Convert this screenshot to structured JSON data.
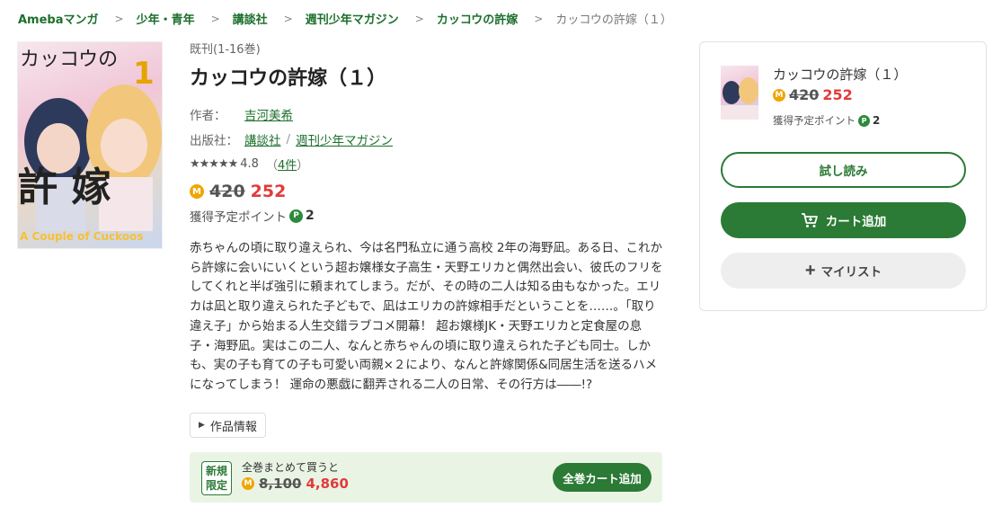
{
  "breadcrumb": {
    "items": [
      "Amebaマンガ",
      "少年・青年",
      "講談社",
      "週刊少年マガジン",
      "カッコウの許嫁"
    ],
    "current": "カッコウの許嫁（１）",
    "separator": ">"
  },
  "cover": {
    "title_text": "カッコウの",
    "title_big": "許  嫁",
    "volume": "1",
    "author_vertical": "吉河美希",
    "subtitle": "A Couple of Cuckoos"
  },
  "book": {
    "vol_status": "既刊(1-16巻)",
    "title": "カッコウの許嫁（１）",
    "author_label": "作者：",
    "author": "吉河美希",
    "publisher_label": "出版社：",
    "publisher": "講談社",
    "magazine": "週刊少年マガジン",
    "stars": "★★★★★",
    "rating": "4.8",
    "review_count": "4件",
    "old_price": "420",
    "new_price": "252",
    "coin_label": "M",
    "points_label": "獲得予定ポイント",
    "points_badge": "P",
    "points": "2"
  },
  "description": "赤ちゃんの頃に取り違えられ、今は名門私立に通う高校 2年の海野凪。ある日、これから許嫁に会いにいくという超お嬢様女子高生・天野エリカと偶然出会い、彼氏のフリをしてくれと半ば強引に頼まれてしまう。だが、その時の二人は知る由もなかった。エリカは凪と取り違えられた子どもで、凪はエリカの許嫁相手だということを……。「取り違え子」から始まる人生交錯ラブコメ開幕！ 超お嬢様JK・天野エリカと定食屋の息子・海野凪。実はこの二人、なんと赤ちゃんの頃に取り違えられた子ども同士。しかも、実の子も育ての子も可愛い両親×２により、なんと許嫁関係&同居生活を送るハメになってしまう！ 運命の悪戯に翻弄される二人の日常、その行方は――!?",
  "info_button": "作品情報",
  "bulk": {
    "badge": "新規限定",
    "text": "全巻まとめて買うと",
    "old_price": "8,100",
    "new_price": "4,860",
    "button": "全巻カート追加"
  },
  "panel": {
    "title": "カッコウの許嫁（１）",
    "old_price": "420",
    "new_price": "252",
    "points_label": "獲得予定ポイント",
    "points": "2",
    "try_button": "試し読み",
    "cart_button": "カート追加",
    "mylist_button": "マイリスト"
  },
  "colors": {
    "brand_green": "#2b7a35",
    "link_green": "#1c6f2c",
    "sale_red": "#e23b3b",
    "coin_gold": "#f0a500",
    "bulk_bg": "#eaf4e4"
  },
  "icons": [
    "chevron-right-icon",
    "star-icon",
    "coin-icon",
    "point-icon",
    "triangle-right-icon",
    "cart-icon",
    "plus-icon"
  ]
}
